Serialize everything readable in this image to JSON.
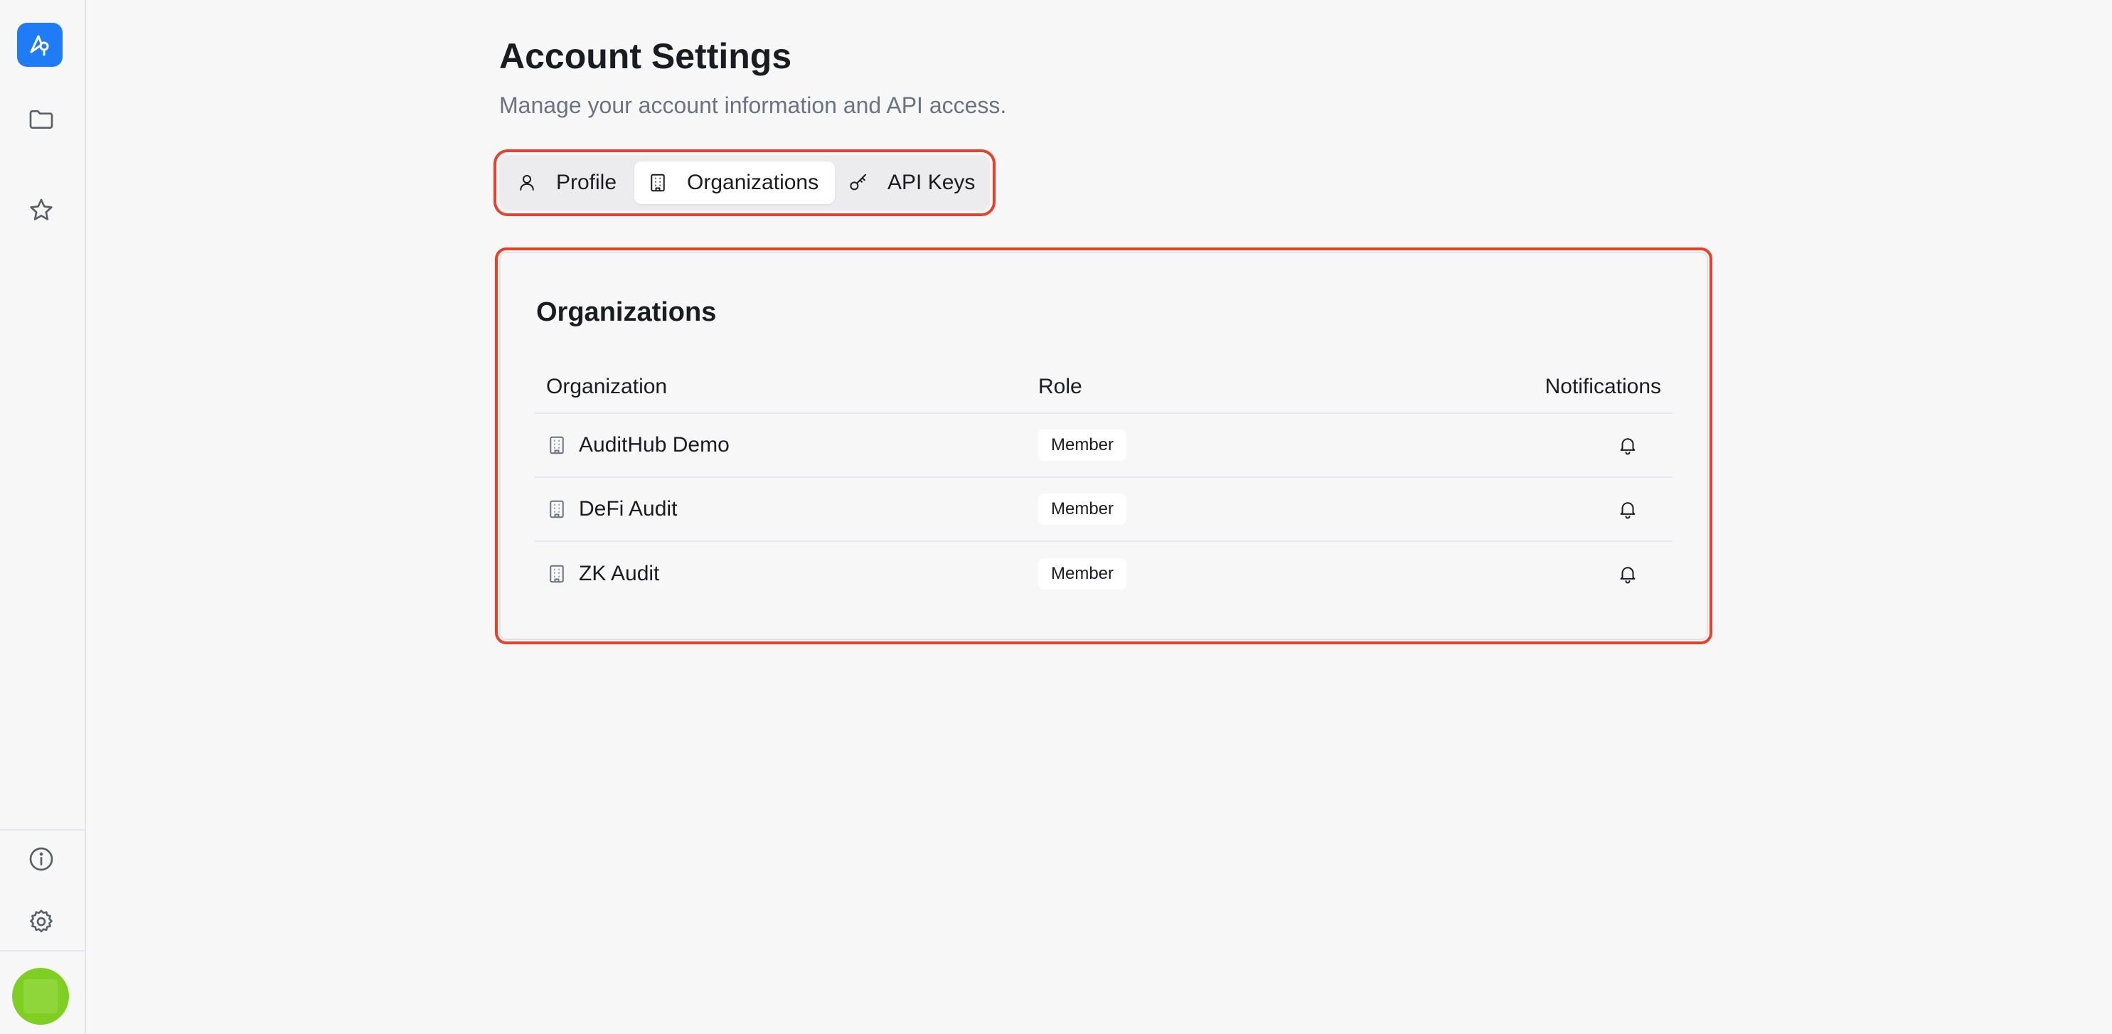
{
  "sidebar": {
    "logo_icon": "logo-icon",
    "items": [
      {
        "name": "folder-icon"
      },
      {
        "name": "star-icon"
      }
    ],
    "bottom_items": [
      {
        "name": "info-icon"
      },
      {
        "name": "gear-icon"
      }
    ],
    "avatar_color": "#7fcf22"
  },
  "page": {
    "title": "Account Settings",
    "subtitle": "Manage your account information and API access."
  },
  "tabs": [
    {
      "label": "Profile",
      "icon": "user-icon",
      "active": false
    },
    {
      "label": "Organizations",
      "icon": "building-icon",
      "active": true
    },
    {
      "label": "API Keys",
      "icon": "key-icon",
      "active": false
    }
  ],
  "organizations": {
    "title": "Organizations",
    "columns": {
      "organization": "Organization",
      "role": "Role",
      "notifications": "Notifications"
    },
    "rows": [
      {
        "name": "AuditHub Demo",
        "role": "Member"
      },
      {
        "name": "DeFi Audit",
        "role": "Member"
      },
      {
        "name": "ZK Audit",
        "role": "Member"
      }
    ]
  },
  "colors": {
    "accent": "#1f7cf5",
    "highlight": "#e8402a"
  }
}
